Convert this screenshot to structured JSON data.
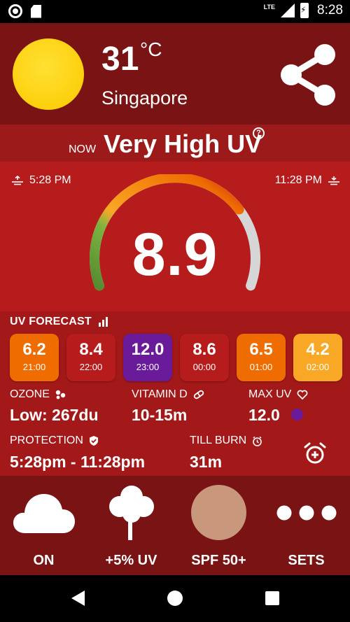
{
  "status_bar": {
    "time": "8:28",
    "network": "LTE"
  },
  "header": {
    "temperature": "31",
    "unit": "°C",
    "city": "Singapore"
  },
  "now": {
    "label": "NOW",
    "level_text": "Very High UV"
  },
  "gauge": {
    "sunrise_time": "5:28 PM",
    "sunset_time": "11:28 PM",
    "uv_index": "8.9",
    "uv_fraction": 0.74
  },
  "forecast": {
    "title": "UV FORECAST",
    "items": [
      {
        "value": "6.2",
        "time": "21:00",
        "color": "#ef6c00"
      },
      {
        "value": "8.4",
        "time": "22:00",
        "color": "#b71c1c"
      },
      {
        "value": "12.0",
        "time": "23:00",
        "color": "#6a1b9a"
      },
      {
        "value": "8.6",
        "time": "00:00",
        "color": "#b71c1c"
      },
      {
        "value": "6.5",
        "time": "01:00",
        "color": "#ef6c00"
      },
      {
        "value": "4.2",
        "time": "02:00",
        "color": "#f9a825"
      }
    ]
  },
  "stats": {
    "ozone_label": "OZONE",
    "ozone_value": "Low: 267du",
    "vitamin_label": "VITAMIN D",
    "vitamin_value": "10-15m",
    "maxuv_label": "MAX UV",
    "maxuv_value": "12.0",
    "protection_label": "PROTECTION",
    "protection_value": "5:28pm - 11:28pm",
    "burn_label": "TILL BURN",
    "burn_value": "31m"
  },
  "actions": [
    {
      "label": "ON",
      "icon": "cloud-icon"
    },
    {
      "label": "+5% UV",
      "icon": "tree-icon"
    },
    {
      "label": "SPF 50+",
      "icon": "skin-tone-icon",
      "color": "#c9977c"
    },
    {
      "label": "SETS",
      "icon": "more-icon"
    }
  ],
  "colors": {
    "header_bg": "#7a1414",
    "gauge_bg": "#b71c1c",
    "sun": "#fdd00e",
    "maxuv_dot": "#6a1b9a"
  }
}
